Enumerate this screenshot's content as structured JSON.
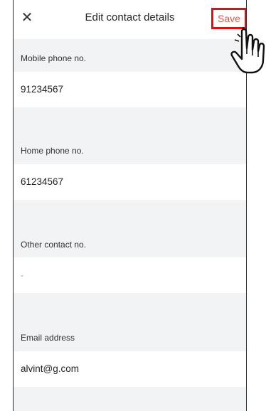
{
  "header": {
    "close_icon": "close-icon",
    "title": "Edit contact details",
    "save_label": "Save",
    "save_color": "#e25a4a",
    "highlight_color": "#e01010"
  },
  "fields": [
    {
      "label": "Mobile phone no.",
      "value": "91234567"
    },
    {
      "label": "Home phone no.",
      "value": "61234567"
    },
    {
      "label": "Other contact no.",
      "value": "-"
    },
    {
      "label": "Email address",
      "value": "alvint@g.com"
    }
  ],
  "cursor_icon": "pointing-hand-icon"
}
